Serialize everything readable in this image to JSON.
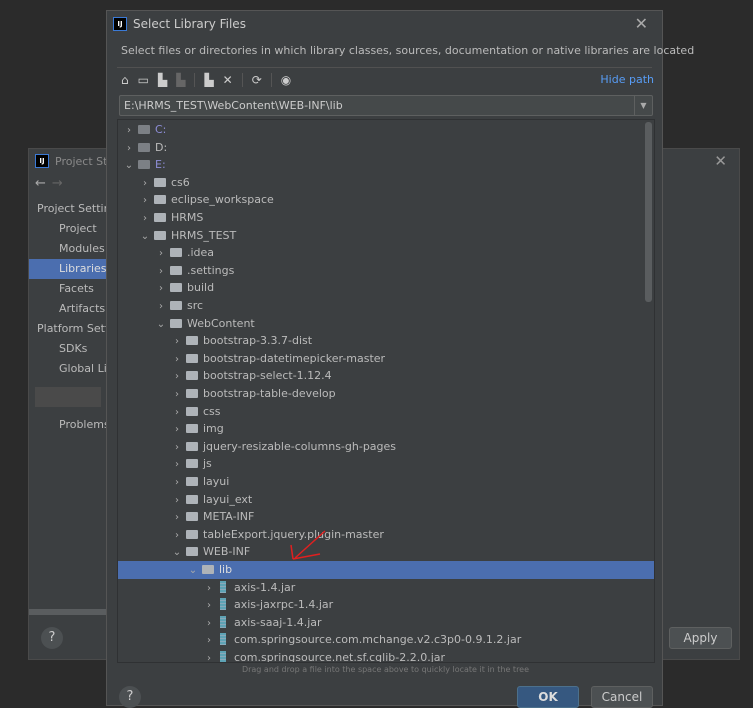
{
  "project_structure": {
    "title": "Project Str",
    "back": "←",
    "forward": "→",
    "sidebar": [
      {
        "label": "Project Settings",
        "type": "h"
      },
      {
        "label": "Project",
        "type": "i"
      },
      {
        "label": "Modules",
        "type": "i"
      },
      {
        "label": "Libraries",
        "type": "i",
        "selected": true
      },
      {
        "label": "Facets",
        "type": "i"
      },
      {
        "label": "Artifacts",
        "type": "i"
      },
      {
        "label": "Platform Settings",
        "type": "h"
      },
      {
        "label": "SDKs",
        "type": "i"
      },
      {
        "label": "Global Libraries",
        "type": "i"
      },
      {
        "label": "",
        "type": "sep"
      },
      {
        "label": "Problems",
        "type": "i"
      }
    ],
    "apply_label": "Apply",
    "help": "?",
    "close": "✕"
  },
  "dialog": {
    "title": "Select Library Files",
    "close": "✕",
    "description": "Select files or directories in which library classes, sources, documentation or native libraries are located",
    "toolbar": [
      {
        "icon": "home-icon",
        "glyph": "⌂"
      },
      {
        "icon": "desktop-icon",
        "glyph": "▭"
      },
      {
        "icon": "project-folder-icon",
        "glyph": "▙"
      },
      {
        "icon": "module-folder-icon",
        "glyph": "▙",
        "disabled": true
      },
      {
        "sep": true
      },
      {
        "icon": "new-folder-icon",
        "glyph": "▙"
      },
      {
        "icon": "delete-icon",
        "glyph": "✕"
      },
      {
        "sep": true
      },
      {
        "icon": "refresh-icon",
        "glyph": "⟳"
      },
      {
        "sep": true
      },
      {
        "icon": "show-hidden-icon",
        "glyph": "◉"
      }
    ],
    "hide_path": "Hide path",
    "path": "E:\\HRMS_TEST\\WebContent\\WEB-INF\\lib",
    "tree": [
      {
        "label": "C:",
        "depth": 0,
        "kind": "drive",
        "open": false
      },
      {
        "label": "D:",
        "depth": 0,
        "kind": "drive",
        "open": false,
        "plain": true
      },
      {
        "label": "E:",
        "depth": 0,
        "kind": "drive",
        "open": true
      },
      {
        "label": "cs6",
        "depth": 1,
        "kind": "folder",
        "open": false
      },
      {
        "label": "eclipse_workspace",
        "depth": 1,
        "kind": "folder",
        "open": false
      },
      {
        "label": "HRMS",
        "depth": 1,
        "kind": "folder",
        "open": false
      },
      {
        "label": "HRMS_TEST",
        "depth": 1,
        "kind": "folder",
        "open": true
      },
      {
        "label": ".idea",
        "depth": 2,
        "kind": "folder",
        "open": false
      },
      {
        "label": ".settings",
        "depth": 2,
        "kind": "folder",
        "open": false
      },
      {
        "label": "build",
        "depth": 2,
        "kind": "folder",
        "open": false
      },
      {
        "label": "src",
        "depth": 2,
        "kind": "folder",
        "open": false
      },
      {
        "label": "WebContent",
        "depth": 2,
        "kind": "folder",
        "open": true
      },
      {
        "label": "bootstrap-3.3.7-dist",
        "depth": 3,
        "kind": "folder",
        "open": false
      },
      {
        "label": "bootstrap-datetimepicker-master",
        "depth": 3,
        "kind": "folder",
        "open": false
      },
      {
        "label": "bootstrap-select-1.12.4",
        "depth": 3,
        "kind": "folder",
        "open": false
      },
      {
        "label": "bootstrap-table-develop",
        "depth": 3,
        "kind": "folder",
        "open": false
      },
      {
        "label": "css",
        "depth": 3,
        "kind": "folder",
        "open": false
      },
      {
        "label": "img",
        "depth": 3,
        "kind": "folder",
        "open": false
      },
      {
        "label": "jquery-resizable-columns-gh-pages",
        "depth": 3,
        "kind": "folder",
        "open": false
      },
      {
        "label": "js",
        "depth": 3,
        "kind": "folder",
        "open": false
      },
      {
        "label": "layui",
        "depth": 3,
        "kind": "folder",
        "open": false
      },
      {
        "label": "layui_ext",
        "depth": 3,
        "kind": "folder",
        "open": false
      },
      {
        "label": "META-INF",
        "depth": 3,
        "kind": "folder",
        "open": false
      },
      {
        "label": "tableExport.jquery.plugin-master",
        "depth": 3,
        "kind": "folder",
        "open": false
      },
      {
        "label": "WEB-INF",
        "depth": 3,
        "kind": "folder",
        "open": true
      },
      {
        "label": "lib",
        "depth": 4,
        "kind": "folder",
        "open": true,
        "selected": true
      },
      {
        "label": "axis-1.4.jar",
        "depth": 5,
        "kind": "jar",
        "open": false
      },
      {
        "label": "axis-jaxrpc-1.4.jar",
        "depth": 5,
        "kind": "jar",
        "open": false
      },
      {
        "label": "axis-saaj-1.4.jar",
        "depth": 5,
        "kind": "jar",
        "open": false
      },
      {
        "label": "com.springsource.com.mchange.v2.c3p0-0.9.1.2.jar",
        "depth": 5,
        "kind": "jar",
        "open": false
      },
      {
        "label": "com.springsource.net.sf.cglib-2.2.0.jar",
        "depth": 5,
        "kind": "jar",
        "open": false
      }
    ],
    "hint": "Drag and drop a file into the space above to quickly locate it in the tree",
    "ok_label": "OK",
    "cancel_label": "Cancel",
    "help": "?"
  },
  "colors": {
    "selection": "#4b6eaf",
    "link": "#589df6",
    "ok": "#365880",
    "annotation": "#e02020"
  }
}
